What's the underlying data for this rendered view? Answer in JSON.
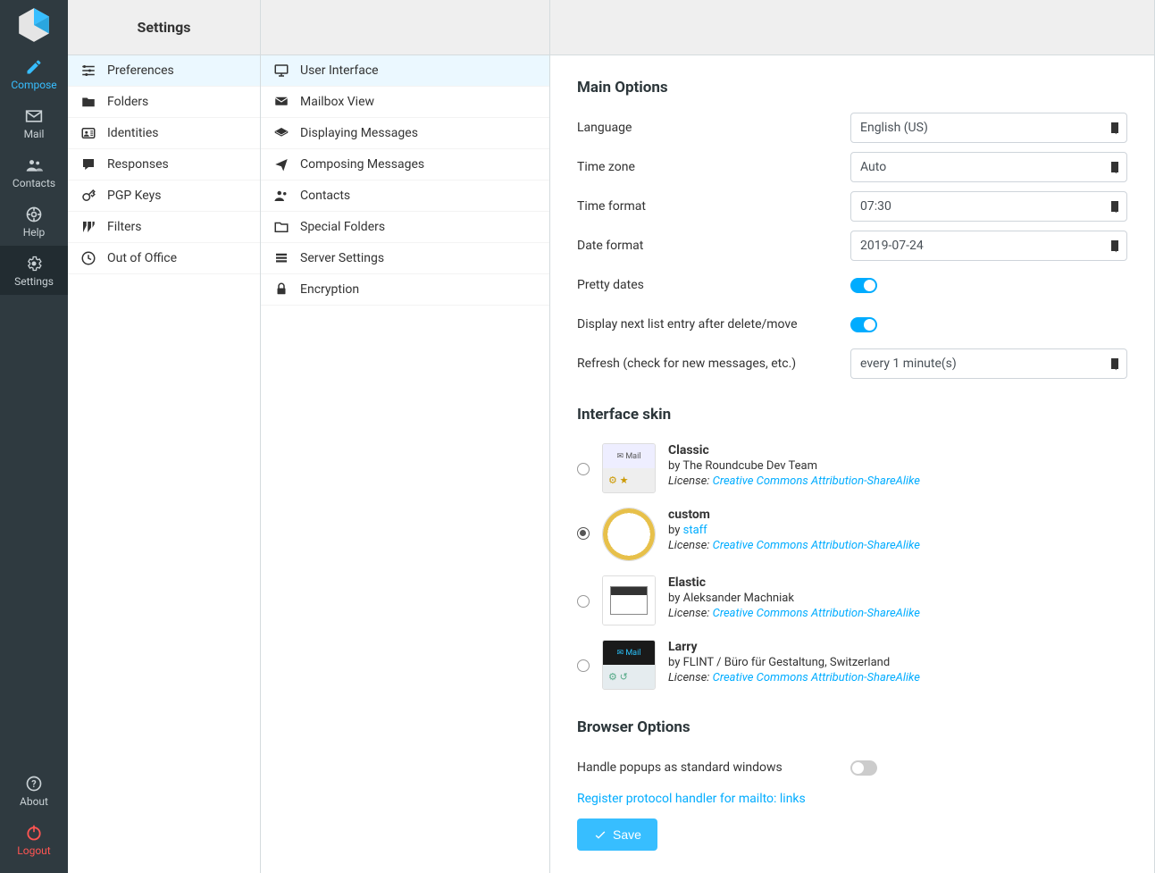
{
  "sidebar": {
    "items": [
      {
        "label": "Compose"
      },
      {
        "label": "Mail"
      },
      {
        "label": "Contacts"
      },
      {
        "label": "Help"
      },
      {
        "label": "Settings"
      }
    ],
    "bottom": [
      {
        "label": "About"
      },
      {
        "label": "Logout"
      }
    ]
  },
  "col1": {
    "header": "Settings",
    "items": [
      {
        "label": "Preferences"
      },
      {
        "label": "Folders"
      },
      {
        "label": "Identities"
      },
      {
        "label": "Responses"
      },
      {
        "label": "PGP Keys"
      },
      {
        "label": "Filters"
      },
      {
        "label": "Out of Office"
      }
    ],
    "selected_index": 0
  },
  "col2": {
    "items": [
      {
        "label": "User Interface"
      },
      {
        "label": "Mailbox View"
      },
      {
        "label": "Displaying Messages"
      },
      {
        "label": "Composing Messages"
      },
      {
        "label": "Contacts"
      },
      {
        "label": "Special Folders"
      },
      {
        "label": "Server Settings"
      },
      {
        "label": "Encryption"
      }
    ],
    "selected_index": 0
  },
  "main": {
    "section_main_options": "Main Options",
    "language_label": "Language",
    "language_value": "English (US)",
    "timezone_label": "Time zone",
    "timezone_value": "Auto",
    "timeformat_label": "Time format",
    "timeformat_value": "07:30",
    "dateformat_label": "Date format",
    "dateformat_value": "2019-07-24",
    "pretty_dates_label": "Pretty dates",
    "pretty_dates_value": true,
    "display_next_label": "Display next list entry after delete/move",
    "display_next_value": true,
    "refresh_label": "Refresh (check for new messages, etc.)",
    "refresh_value": "every 1 minute(s)",
    "section_interface_skin": "Interface skin",
    "skins": [
      {
        "name": "Classic",
        "by_prefix": "by ",
        "by": "The Roundcube Dev Team",
        "by_link": false,
        "license_prefix": "License: ",
        "license": "Creative Commons Attribution-ShareAlike",
        "selected": false
      },
      {
        "name": "custom",
        "by_prefix": "by ",
        "by": "staff",
        "by_link": true,
        "license_prefix": "License: ",
        "license": "Creative Commons Attribution-ShareAlike",
        "selected": true
      },
      {
        "name": "Elastic",
        "by_prefix": "by ",
        "by": "Aleksander Machniak",
        "by_link": false,
        "license_prefix": "License: ",
        "license": "Creative Commons Attribution-ShareAlike",
        "selected": false
      },
      {
        "name": "Larry",
        "by_prefix": "by ",
        "by": "FLINT / Büro für Gestaltung, Switzerland",
        "by_link": false,
        "license_prefix": "License: ",
        "license": "Creative Commons Attribution-ShareAlike",
        "selected": false
      }
    ],
    "section_browser_options": "Browser Options",
    "popups_label": "Handle popups as standard windows",
    "popups_value": false,
    "protocol_link": "Register protocol handler for mailto: links",
    "save_label": "Save"
  }
}
